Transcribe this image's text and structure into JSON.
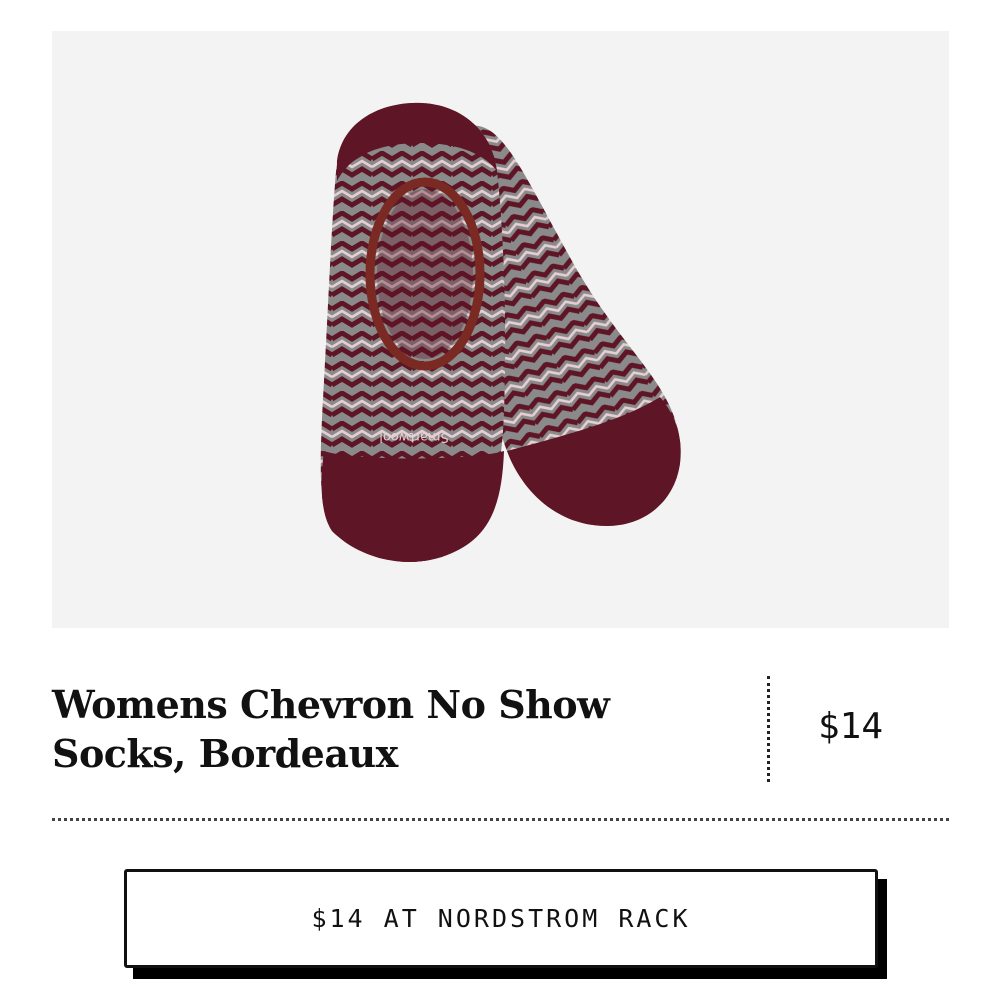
{
  "product": {
    "image_alt": "Womens Chevron No Show Socks, Bordeaux",
    "sock_brand_text": "Smartwool",
    "title": "Womens Chevron No Show Socks, Bordeaux",
    "price": "$14"
  },
  "cta": {
    "label": "$14 AT NORDSTROM RACK"
  },
  "colors": {
    "background": "#ffffff",
    "image_background": "#f4f3f3",
    "sock_bordeaux": "#5e1526",
    "sock_grey": "#8a8a8a",
    "chevron_light": "#e6cfd3",
    "text": "#111111"
  }
}
